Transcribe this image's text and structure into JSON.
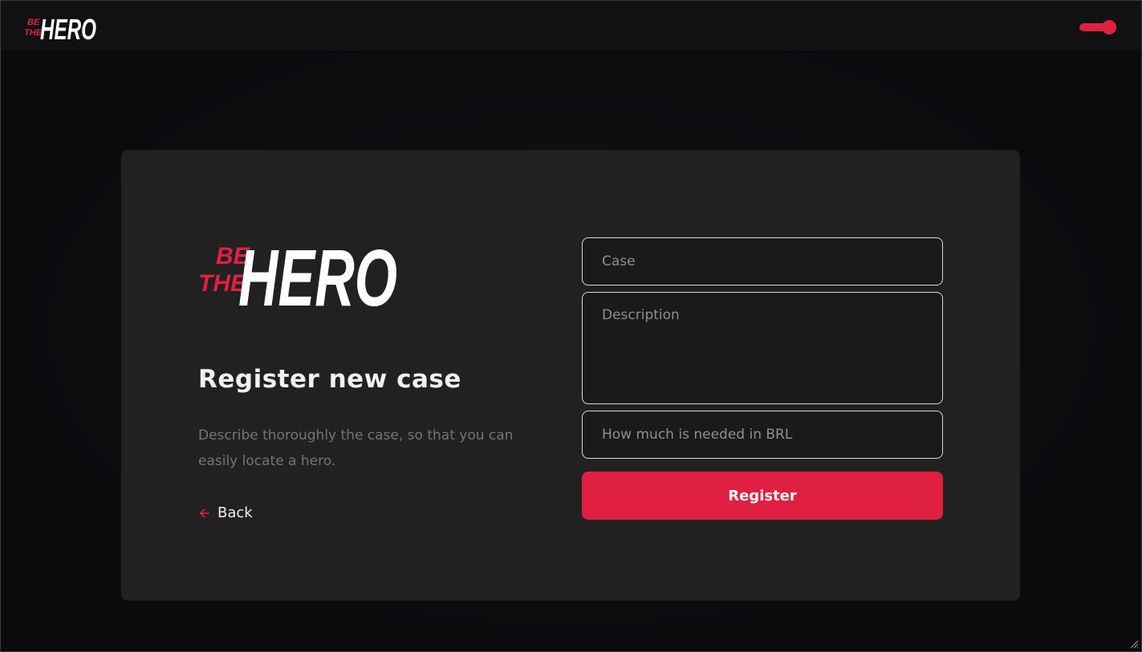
{
  "brand": {
    "logo_text_small_red": "BE THE",
    "logo_text_large_white": "HERO",
    "accent_color": "#e02041"
  },
  "header": {
    "theme_toggle_state": "on"
  },
  "page": {
    "title": "Register new case",
    "description": "Describe thoroughly the case, so that you can easily locate a hero.",
    "back_label": "Back",
    "back_icon": "arrow-left-icon"
  },
  "form": {
    "case_placeholder": "Case",
    "case_value": "",
    "description_placeholder": "Description",
    "description_value": "",
    "value_placeholder": "How much is needed in BRL",
    "value_value": "",
    "submit_label": "Register"
  }
}
